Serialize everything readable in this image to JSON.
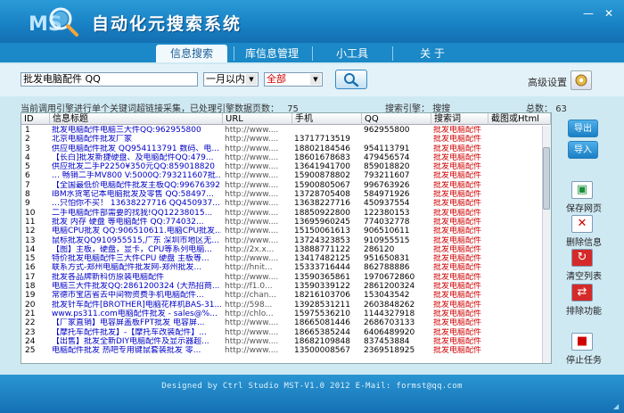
{
  "app": {
    "title": "自动化元搜索系统"
  },
  "tabs": [
    {
      "label": "信息搜索",
      "active": true
    },
    {
      "label": "库信息管理",
      "active": false
    },
    {
      "label": "小工具",
      "active": false
    },
    {
      "label": "关  于",
      "active": false
    }
  ],
  "search": {
    "keyword": "批发电脑配件 QQ",
    "time_range": "一月以内",
    "scope": "全部",
    "advanced_label": "高级设置"
  },
  "status": {
    "progress_text": "当前调用引擎进行单个关键词超链接采集，已处理引擎数据页数：",
    "pages_processed": "75",
    "engine_label": "搜索引擎：",
    "engine_value": "搜搜",
    "total_label": "总数：",
    "total_value": "63"
  },
  "table": {
    "columns": [
      "ID",
      "信息标题",
      "URL",
      "手机",
      "QQ",
      "搜索词",
      "截图或Html"
    ],
    "rows": [
      [
        "1",
        "批发电脑配件电脑三大件QQ:962955800",
        "http://www....",
        "",
        "962955800",
        "批发电脑配件",
        ""
      ],
      [
        "2",
        "北京电脑配件批发厂家",
        "http://www....",
        "13717713519",
        "",
        "批发电脑配件",
        ""
      ],
      [
        "3",
        "供应电脑配件批发 QQ954113791 数码、电...",
        "http://www....",
        "18802184546",
        "954113791",
        "批发电脑配件",
        ""
      ],
      [
        "4",
        "【长白]批发新捷硬盘、及电脑配件QQ:479...",
        "http://www....",
        "18601678683",
        "479456574",
        "批发电脑配件",
        ""
      ],
      [
        "5",
        "供应批发二手P2250¥350元QQ:859018820",
        "http://www....",
        "13641941700",
        "859018820",
        "批发电脑配件",
        ""
      ],
      [
        "6",
        "…  畅销二手MV800 V:5000Q:793211607批...",
        "http://www....",
        "15900878802",
        "793211607",
        "批发电脑配件",
        ""
      ],
      [
        "7",
        "【全国最低价电脑配件批发主板QQ:99676392...",
        "http://www....",
        "15900805067",
        "996763926",
        "批发电脑配件",
        ""
      ],
      [
        "8",
        "IBM水货笔记本电脑批发及零售 QQ:58497...",
        "http://www....",
        "13728705408",
        "584971926",
        "批发电脑配件",
        ""
      ],
      [
        "9",
        "…只怕你不买！ 13638227716 QQ450937...",
        "http://www....",
        "13638227716",
        "450937554",
        "批发电脑配件",
        ""
      ],
      [
        "10",
        "二手电脑配件部需要的找我!QQ12238015...",
        "http://www....",
        "18850922800",
        "122380153",
        "批发电脑配件",
        ""
      ],
      [
        "11",
        "批发 内存 硬盘 等电脑配件 QQ:774032...",
        "http://www....",
        "13695960245",
        "774032778",
        "批发电脑配件",
        ""
      ],
      [
        "12",
        "电脑CPU批发 QQ:906510611.电脑CPU批发...",
        "http://www....",
        "15150061613",
        "906510611",
        "批发电脑配件",
        ""
      ],
      [
        "13",
        "鼠标批发QQ910955515,广东 深圳市地区无...",
        "http://www....",
        "13724323853",
        "910955515",
        "批发电脑配件",
        ""
      ],
      [
        "14",
        "【图】主板，硬盘，显卡，CPU等系列电脑...",
        "http://2x.x...",
        "13888771122",
        "286120",
        "批发电脑配件",
        ""
      ],
      [
        "15",
        "特价批发电脑配件三大件CPU 硬盘 主板等...",
        "http://www....",
        "13417482125",
        "951650831",
        "批发电脑配件",
        ""
      ],
      [
        "16",
        "联系方式-郑州电脑配件批发网-郑州批发...",
        "http://hnit...",
        "15333716444",
        "862788886",
        "批发电脑配件",
        ""
      ],
      [
        "17",
        "批发各品牌新科仿原装电脑配件",
        "http://www....",
        "13590365861",
        "1970672860",
        "批发电脑配件",
        ""
      ],
      [
        "18",
        "电脑三大件批发QQ:2861200324 (大热招商...",
        "http://f1.0...",
        "13590339122",
        "2861200324",
        "批发电脑配件",
        ""
      ],
      [
        "19",
        "常德市宝店省去中间物资费手机电脑配件...",
        "http://chan...",
        "18216103706",
        "153043542",
        "批发电脑配件",
        ""
      ],
      [
        "20",
        "批发针车配件[BROTHER]电脑花样机BAS-31...",
        "http://598...",
        "13928531211",
        "2603848262",
        "批发电脑配件",
        ""
      ],
      [
        "21",
        "www.ps311.com电脑配件批发 - sales@%...",
        "http://chlo...",
        "15975536210",
        "1144327918",
        "批发电脑配件",
        ""
      ],
      [
        "22",
        "【厂家直销】电容屏盖板FPT批发 电容屏...",
        "http://www....",
        "18665081446",
        "2686703133",
        "批发电脑配件",
        ""
      ],
      [
        "23",
        "【摩托车配件批发】-【摩托车改装配件】...",
        "http://www....",
        "18665385244",
        "6406489920",
        "批发电脑配件",
        ""
      ],
      [
        "24",
        "【出售】批发全新DIY电脑配件及显示器超...",
        "http://www....",
        "18682109848",
        "837453884",
        "批发电脑配件",
        ""
      ],
      [
        "25",
        "电脑配件批发 热吧专用键鼠套装批发 零...",
        "http://www....",
        "13500008567",
        "2369518925",
        "批发电脑配件",
        ""
      ]
    ]
  },
  "side_buttons": {
    "export": "导出",
    "import": "导入",
    "save_page": "保存网页",
    "delete_info": "删除信息",
    "clear_list": "清空列表",
    "exclude": "排除功能",
    "stop_task": "停止任务"
  },
  "footer": {
    "text": "Designed by Ctrl Studio  MST-V1.0 2012     E-Mail: formst@qq.com"
  },
  "colors": {
    "titlebar": "#1880c4",
    "accent_red": "#d00000",
    "link_blue": "#0000c8"
  }
}
